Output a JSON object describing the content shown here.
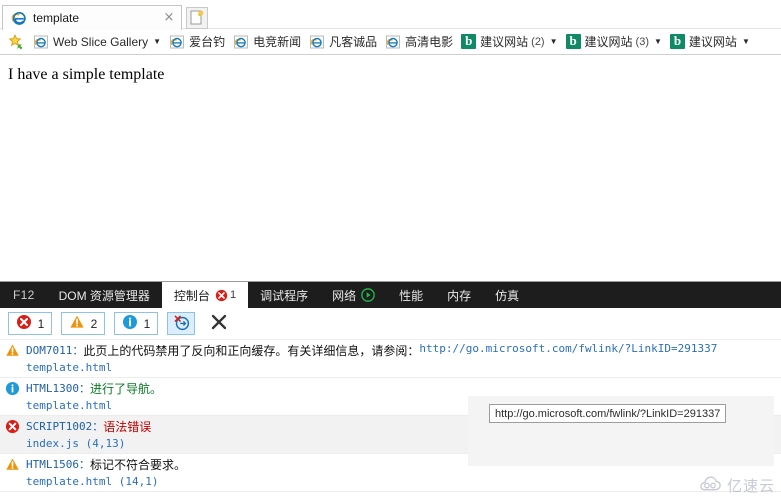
{
  "browser": {
    "tab": {
      "title": "template",
      "favicon": "ie-icon",
      "close_label": "×"
    },
    "new_tab_label": "",
    "favorites_bar": {
      "star_icon": "favorites-star-icon",
      "items": [
        {
          "icon": "ie-icon",
          "label": "Web Slice Gallery",
          "count": "",
          "caret": "▼"
        },
        {
          "icon": "ie-icon",
          "label": "爱台钓",
          "count": "",
          "caret": ""
        },
        {
          "icon": "ie-icon",
          "label": "电竞新闻",
          "count": "",
          "caret": ""
        },
        {
          "icon": "ie-icon",
          "label": "凡客诚品",
          "count": "",
          "caret": ""
        },
        {
          "icon": "ie-icon",
          "label": "高清电影",
          "count": "",
          "caret": ""
        },
        {
          "icon": "bing-icon",
          "label": "建议网站",
          "count": "(2)",
          "caret": "▼"
        },
        {
          "icon": "bing-icon",
          "label": "建议网站",
          "count": "(3)",
          "caret": "▼"
        },
        {
          "icon": "bing-icon",
          "label": "建议网站",
          "count": "",
          "caret": "▼"
        }
      ]
    }
  },
  "page": {
    "body_text": "I have a simple template"
  },
  "devtools": {
    "f12_label": "F12",
    "tabs": [
      {
        "label": "DOM 资源管理器",
        "active": false,
        "badge": "",
        "badge_icon": ""
      },
      {
        "label": "控制台",
        "active": true,
        "badge": "1",
        "badge_icon": "error-icon"
      },
      {
        "label": "调试程序",
        "active": false,
        "badge": "",
        "badge_icon": ""
      },
      {
        "label": "网络",
        "active": false,
        "badge": "",
        "badge_icon": "play-icon"
      },
      {
        "label": "性能",
        "active": false,
        "badge": "",
        "badge_icon": ""
      },
      {
        "label": "内存",
        "active": false,
        "badge": "",
        "badge_icon": ""
      },
      {
        "label": "仿真",
        "active": false,
        "badge": "",
        "badge_icon": ""
      }
    ],
    "console_toolbar": {
      "error_filter": {
        "icon": "error-icon",
        "count": "1"
      },
      "warning_filter": {
        "icon": "warning-icon",
        "count": "2"
      },
      "info_filter": {
        "icon": "info-icon",
        "count": "1"
      },
      "clear_on_navigate": {
        "icon": "clear-on-navigate-icon",
        "active": true
      },
      "clear_console": {
        "icon": "clear-icon"
      }
    },
    "messages": [
      {
        "level": "warning",
        "icon": "warning-icon",
        "code": "DOM7011：",
        "text": "此页上的代码禁用了反向和正向缓存。有关详细信息，请参阅：",
        "link": "http://go.microsoft.com/fwlink/?LinkID=291337",
        "source": "template.html",
        "highlight": false
      },
      {
        "level": "info",
        "icon": "info-icon",
        "code": "HTML1300：",
        "text": "进行了导航。",
        "link": "",
        "source": "template.html",
        "highlight": false
      },
      {
        "level": "error",
        "icon": "error-icon",
        "code": "SCRIPT1002：",
        "text": "语法错误",
        "link": "",
        "source": "index.js (4,13)",
        "highlight": true
      },
      {
        "level": "warning",
        "icon": "warning-icon",
        "code": "HTML1506：",
        "text": "标记不符合要求。",
        "link": "",
        "source": "template.html (14,1)",
        "highlight": false
      }
    ]
  },
  "status_tooltip": {
    "text": "http://go.microsoft.com/fwlink/?LinkID=291337"
  },
  "watermark": {
    "text": "亿速云",
    "icon": "cloud-logo-icon"
  },
  "colors": {
    "error": "#d91e18",
    "warning": "#f0920a",
    "info": "#1e9ad6",
    "link": "#2a6fbd",
    "devtools_bar": "#1d1d1d",
    "bing_green": "#0f8a64"
  }
}
